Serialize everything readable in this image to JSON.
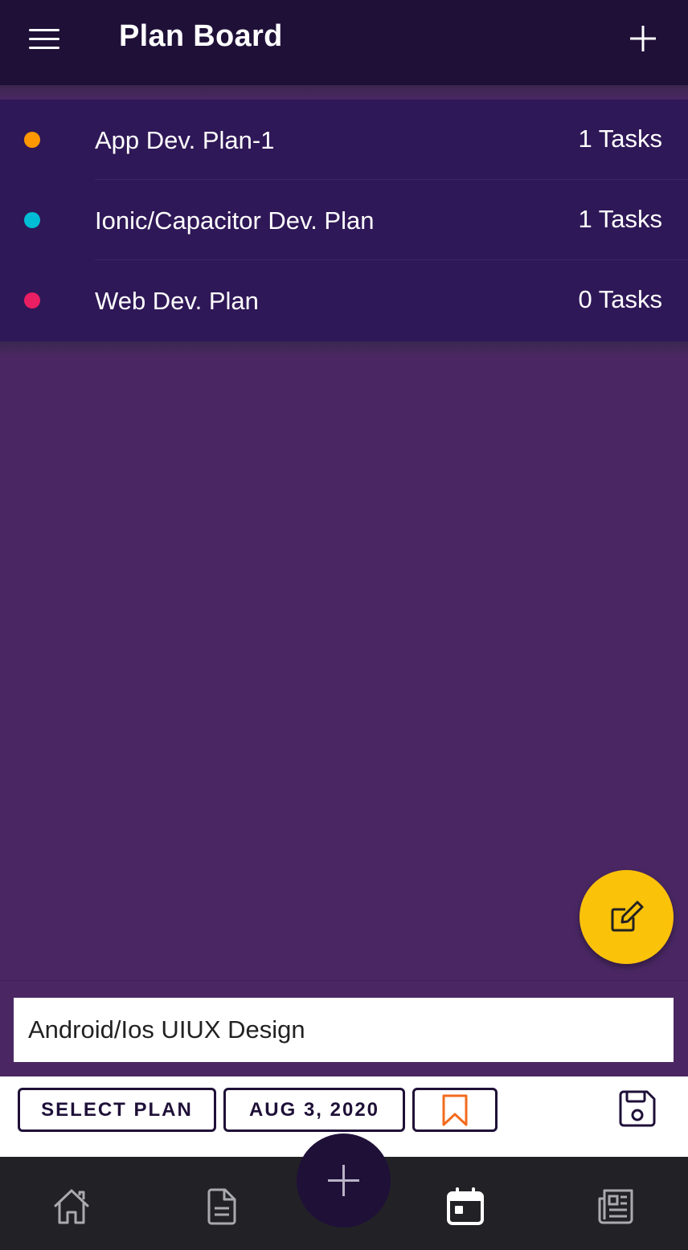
{
  "header": {
    "title": "Plan Board",
    "menu_icon": "hamburger-menu-icon",
    "add_icon": "plus-icon"
  },
  "plans": [
    {
      "name": "App Dev. Plan-1",
      "count": "1 Tasks",
      "color": "#ff9800"
    },
    {
      "name": "Ionic/Capacitor Dev. Plan",
      "count": "1 Tasks",
      "color": "#00bcd4"
    },
    {
      "name": "Web Dev. Plan",
      "count": "0 Tasks",
      "color": "#e91e63"
    }
  ],
  "task_input": {
    "value": "Android/Ios UIUX Design"
  },
  "toolbar": {
    "select_plan_label": "SELECT PLAN",
    "date_label": "AUG 3, 2020",
    "bookmark_icon": "bookmark-icon",
    "save_icon": "floppy-disk-icon"
  },
  "bottom_nav": {
    "items": [
      "home-icon",
      "document-icon",
      "calendar-icon",
      "newspaper-icon"
    ],
    "center_icon": "plus-icon"
  },
  "colors": {
    "header_bg": "#1f1038",
    "list_bg": "#2f1857",
    "body_bg": "#4a2763",
    "fab_yellow": "#fbc20a",
    "bookmark_orange": "#f26b1d",
    "nav_bg": "#222226"
  }
}
